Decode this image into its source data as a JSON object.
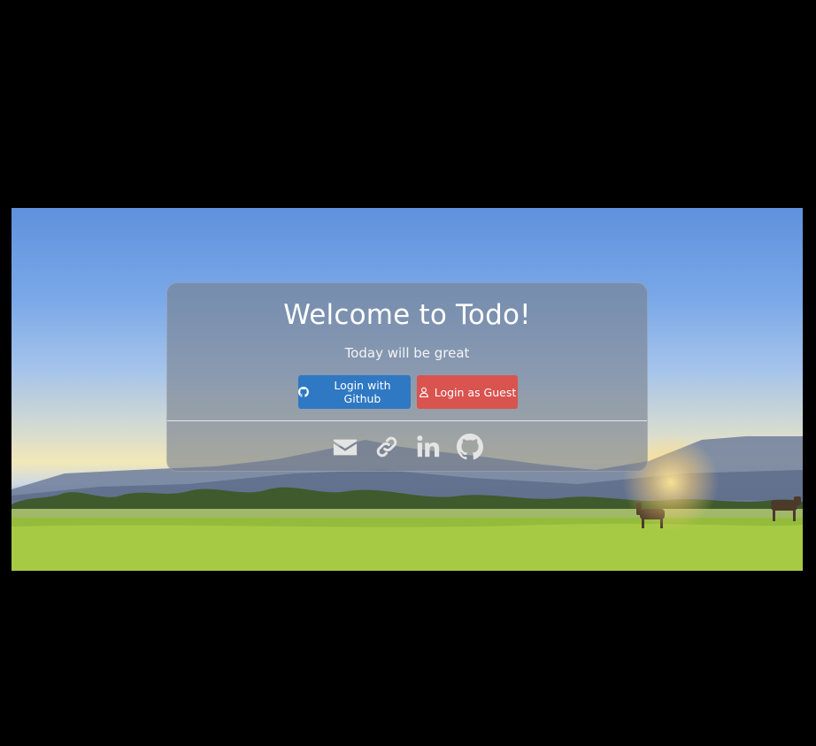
{
  "card": {
    "title": "Welcome to Todo!",
    "subtitle": "Today will be great",
    "buttons": {
      "github_label": "Login with Github",
      "guest_label": "Login as Guest"
    }
  },
  "icons": {
    "github_button_icon": "github-icon",
    "guest_button_icon": "user-icon",
    "footer": [
      "envelope-icon",
      "link-icon",
      "linkedin-icon",
      "github-icon"
    ]
  },
  "colors": {
    "github_button": "#2f78c3",
    "guest_button": "#d9534f",
    "card_overlay": "rgba(120,128,140,0.62)"
  }
}
